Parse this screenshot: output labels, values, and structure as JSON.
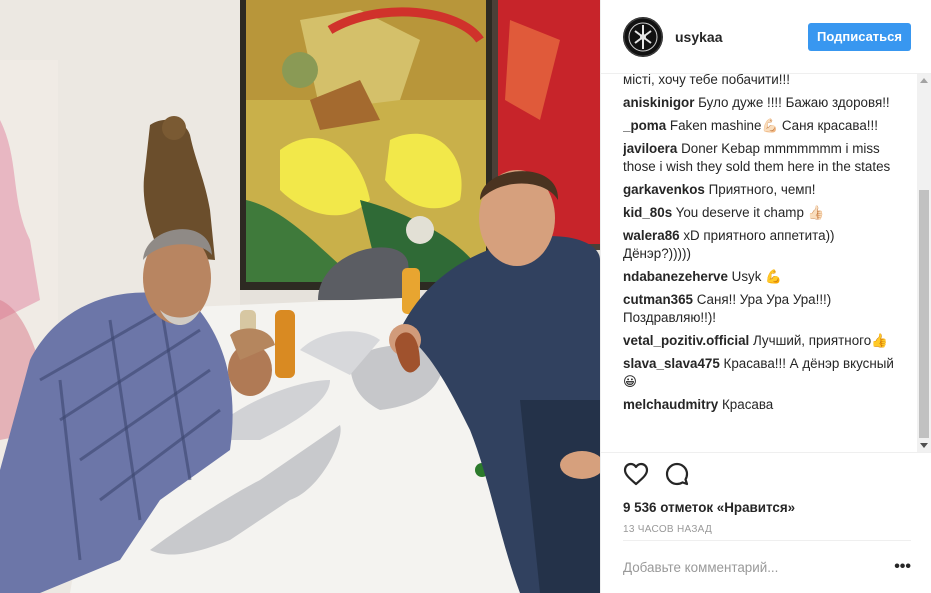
{
  "header": {
    "username": "usykaa",
    "follow_label": "Подписаться"
  },
  "comments": [
    {
      "user": "",
      "text": "місті, хочу тебе побачити!!!"
    },
    {
      "user": "aniskinigor",
      "text": "Було дуже !!!! Бажаю здоровя!!"
    },
    {
      "user": "_poma",
      "text": "Faken mashine💪🏻 Саня красава!!!"
    },
    {
      "user": "javiloera",
      "text": "Doner Kebap mmmmmmm i miss those i wish they sold them here in the states"
    },
    {
      "user": "garkavenkos",
      "text": "Приятного, чемп!"
    },
    {
      "user": "kid_80s",
      "text": "You deserve it champ 👍🏻"
    },
    {
      "user": "walera86",
      "text": "xD приятного аппетита)) Дёнэр?)))))"
    },
    {
      "user": "ndabanezeherve",
      "text": "Usyk 💪"
    },
    {
      "user": "cutman365",
      "text": "Саня!! Ура Ура Ура!!!) Поздравляю!!)!"
    },
    {
      "user": "vetal_pozitiv.official",
      "text": "Лучший, приятного👍"
    },
    {
      "user": "slava_slava475",
      "text": "Красава!!! А дёнэр вкусный 😀"
    },
    {
      "user": "melchaudmitry",
      "text": "Красава"
    }
  ],
  "actions": {
    "like_icon": "heart-icon",
    "comment_icon": "comment-icon",
    "likes_text": "9 536 отметок «Нравится»",
    "time_text": "13 часов назад"
  },
  "add_comment": {
    "placeholder": "Добавьте комментарий...",
    "more_label": "•••"
  },
  "colors": {
    "follow_button": "#3897f0",
    "border": "#efefef",
    "muted_text": "#999999"
  }
}
